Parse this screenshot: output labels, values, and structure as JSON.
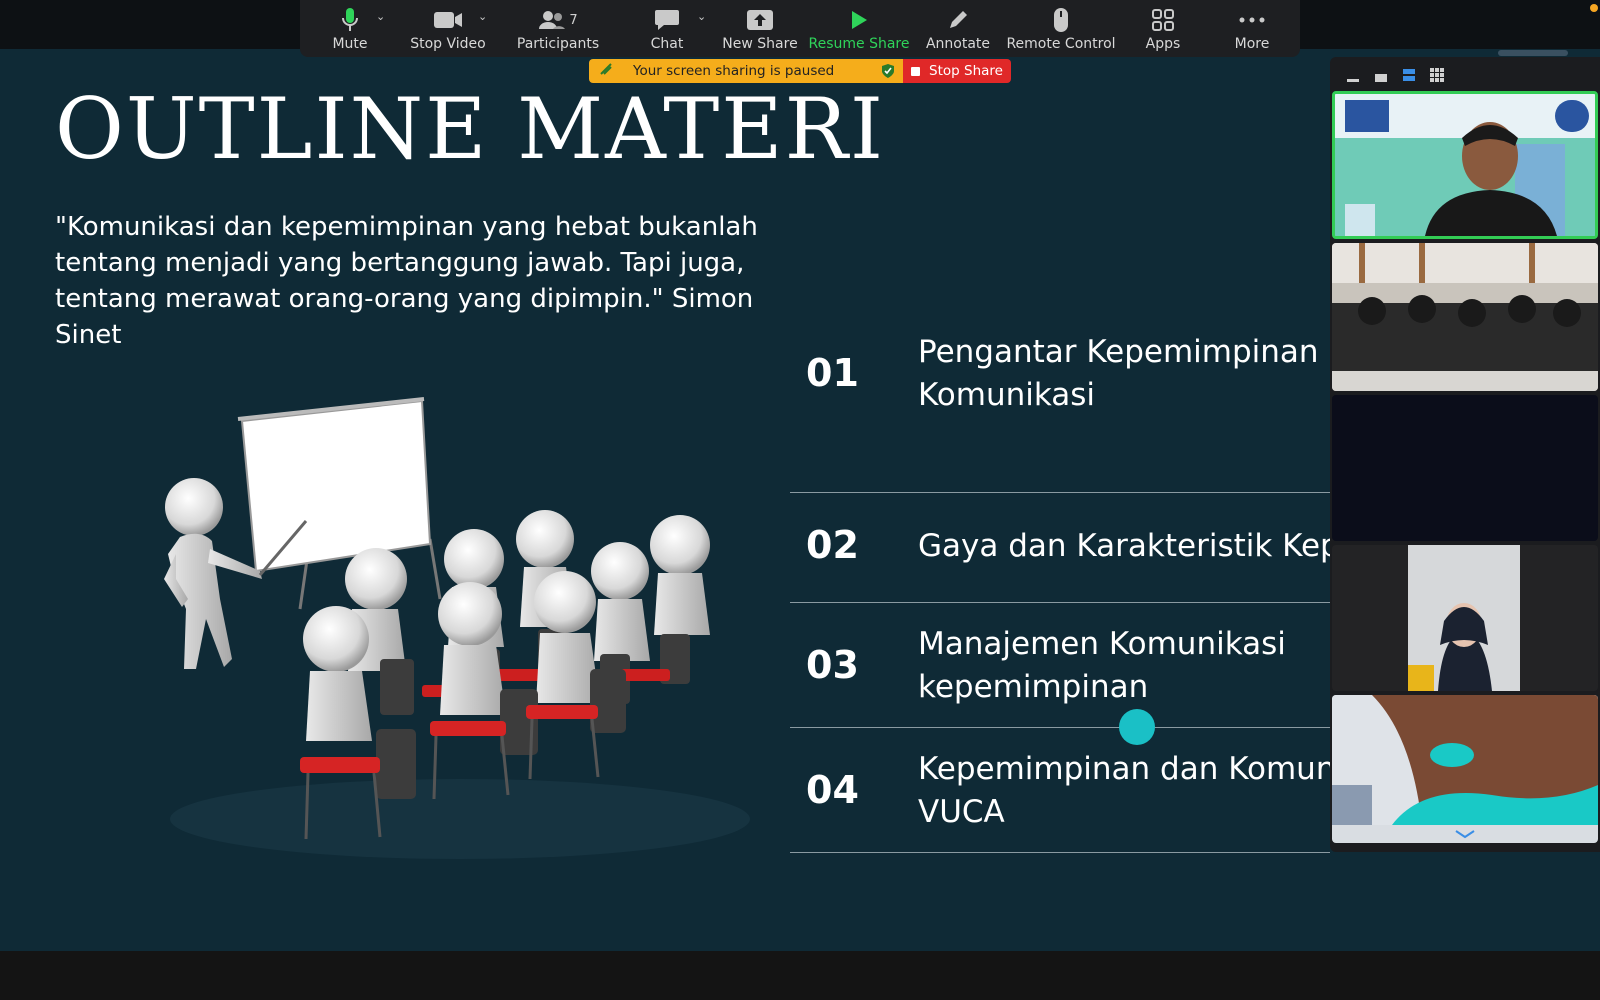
{
  "toolbar": {
    "mute_label": "Mute",
    "stop_video_label": "Stop Video",
    "participants_label": "Participants",
    "participants_count": "7",
    "chat_label": "Chat",
    "new_share_label": "New Share",
    "resume_share_label": "Resume Share",
    "annotate_label": "Annotate",
    "remote_control_label": "Remote Control",
    "apps_label": "Apps",
    "more_label": "More"
  },
  "share_banner": {
    "paused_message": "Your screen sharing is paused",
    "stop_share_label": "Stop Share"
  },
  "slide": {
    "title": "OUTLINE MATERI",
    "quote": "\"Komunikasi dan kepemimpinan yang hebat bukanlah tentang menjadi yang bertanggung jawab. Tapi juga, tentang merawat orang-orang yang dipimpin.\" Simon Sinet",
    "items": [
      {
        "num": "01",
        "line1": "Pengantar Kepemimpinan d",
        "line2": "Komunikasi"
      },
      {
        "num": "02",
        "line1": "Gaya dan Karakteristik Kepe",
        "line2": ""
      },
      {
        "num": "03",
        "line1": "Manajemen Komunikasi",
        "line2": "kepemimpinan"
      },
      {
        "num": "04",
        "line1": "Kepemimpinan dan Komuni",
        "line2": "VUCA"
      }
    ]
  },
  "colors": {
    "slide_bg": "#0f2a36",
    "toolbar_bg": "#1e1f22",
    "resume_green": "#2fd45a",
    "paused_yellow": "#f5ad1b",
    "stop_red": "#e02828",
    "active_speaker_border": "#33cc55",
    "cursor_dot": "#1ac0c6"
  },
  "icons": {
    "mute": "microphone-icon",
    "video": "video-camera-icon",
    "participants": "people-icon",
    "chat": "chat-bubble-icon",
    "new_share": "upload-arrow-icon",
    "resume": "play-icon",
    "annotate": "pencil-icon",
    "remote": "mouse-icon",
    "apps": "apps-grid-icon",
    "more": "ellipsis-icon"
  }
}
